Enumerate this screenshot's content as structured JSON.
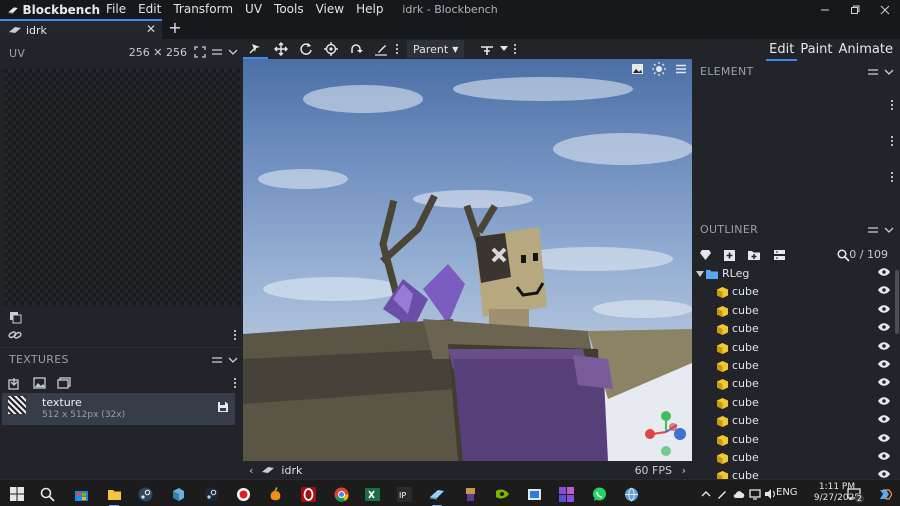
{
  "app": {
    "name": "Blockbench",
    "window_title": "idrk - Blockbench",
    "menu": [
      "File",
      "Edit",
      "Transform",
      "UV",
      "Tools",
      "View",
      "Help"
    ]
  },
  "tabs": {
    "active_file": "idrk"
  },
  "uv_panel": {
    "title": "UV",
    "size": "256 ✕ 256"
  },
  "textures_panel": {
    "title": "TEXTURES",
    "item_name": "texture",
    "item_resolution": "512 x 512px (32x)"
  },
  "toolbar": {
    "pivot_mode": "Parent"
  },
  "viewport": {
    "model_name": "idrk",
    "fps": "60 FPS"
  },
  "modes": [
    "Edit",
    "Paint",
    "Animate"
  ],
  "element_panel": {
    "title": "ELEMENT"
  },
  "outliner": {
    "title": "OUTLINER",
    "count": "0 / 109",
    "group": "RLeg",
    "items": [
      "cube",
      "cube",
      "cube",
      "cube",
      "cube",
      "cube",
      "cube",
      "cube",
      "cube",
      "cube",
      "cube"
    ]
  },
  "taskbar": {
    "language": "ENG",
    "time": "1:11 PM",
    "date": "9/27/2025",
    "notification_count": "2"
  },
  "colors": {
    "accent": "#3c8ce7",
    "panel_bg": "#22242a",
    "cube_icon": "#f0c830",
    "folder_icon": "#5aa9f0"
  }
}
